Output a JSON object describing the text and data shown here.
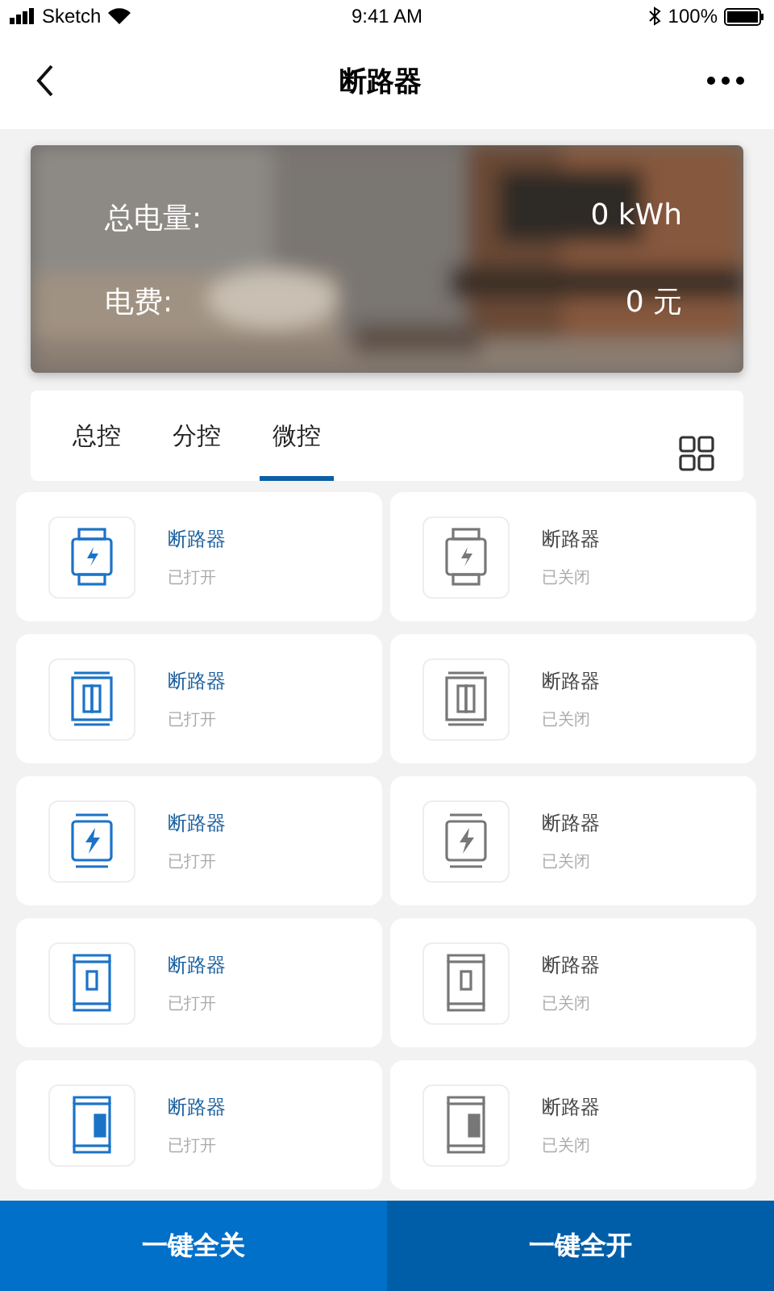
{
  "status_bar": {
    "carrier": "Sketch",
    "time": "9:41 AM",
    "battery": "100%"
  },
  "nav": {
    "title": "断路器"
  },
  "summary": {
    "rows": [
      {
        "label": "总电量:",
        "value": "0 kWh"
      },
      {
        "label": "电费:",
        "value": "0 元"
      }
    ]
  },
  "tabs": [
    {
      "label": "总控",
      "selected": false
    },
    {
      "label": "分控",
      "selected": false
    },
    {
      "label": "微控",
      "selected": true
    }
  ],
  "devices": [
    {
      "kind": "watch",
      "name": "断路器",
      "status": "已打开",
      "on": true
    },
    {
      "kind": "watch",
      "name": "断路器",
      "status": "已关闭",
      "on": false
    },
    {
      "kind": "double",
      "name": "断路器",
      "status": "已打开",
      "on": true
    },
    {
      "kind": "double",
      "name": "断路器",
      "status": "已关闭",
      "on": false
    },
    {
      "kind": "bolt",
      "name": "断路器",
      "status": "已打开",
      "on": true
    },
    {
      "kind": "bolt",
      "name": "断路器",
      "status": "已关闭",
      "on": false
    },
    {
      "kind": "small",
      "name": "断路器",
      "status": "已打开",
      "on": true
    },
    {
      "kind": "small",
      "name": "断路器",
      "status": "已关闭",
      "on": false
    },
    {
      "kind": "large",
      "name": "断路器",
      "status": "已打开",
      "on": true
    },
    {
      "kind": "large",
      "name": "断路器",
      "status": "已关闭",
      "on": false
    }
  ],
  "actions": [
    {
      "label": "一键全关",
      "kind": "primary"
    },
    {
      "label": "一键全开",
      "kind": "secondary"
    }
  ]
}
